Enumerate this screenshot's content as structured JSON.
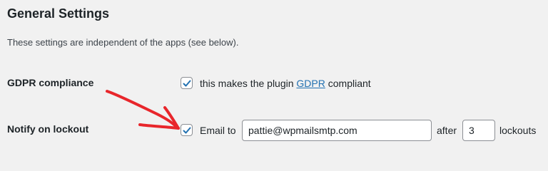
{
  "section": {
    "title": "General Settings",
    "description": "These settings are independent of the apps (see below)."
  },
  "gdpr": {
    "label": "GDPR compliance",
    "checked": true,
    "text_before": "this makes the plugin ",
    "link_text": "GDPR",
    "text_after": " compliant"
  },
  "notify": {
    "label": "Notify on lockout",
    "checked": true,
    "email_prefix": "Email to",
    "email_value": "pattie@wpmailsmtp.com",
    "after_text": "after",
    "lockout_count": "3",
    "lockouts_text": "lockouts"
  },
  "colors": {
    "link": "#2271b1",
    "checkmark": "#2271b1",
    "annotation_arrow": "#e8262b"
  },
  "annotation": {
    "icon": "red-hand-drawn-arrow-icon"
  }
}
